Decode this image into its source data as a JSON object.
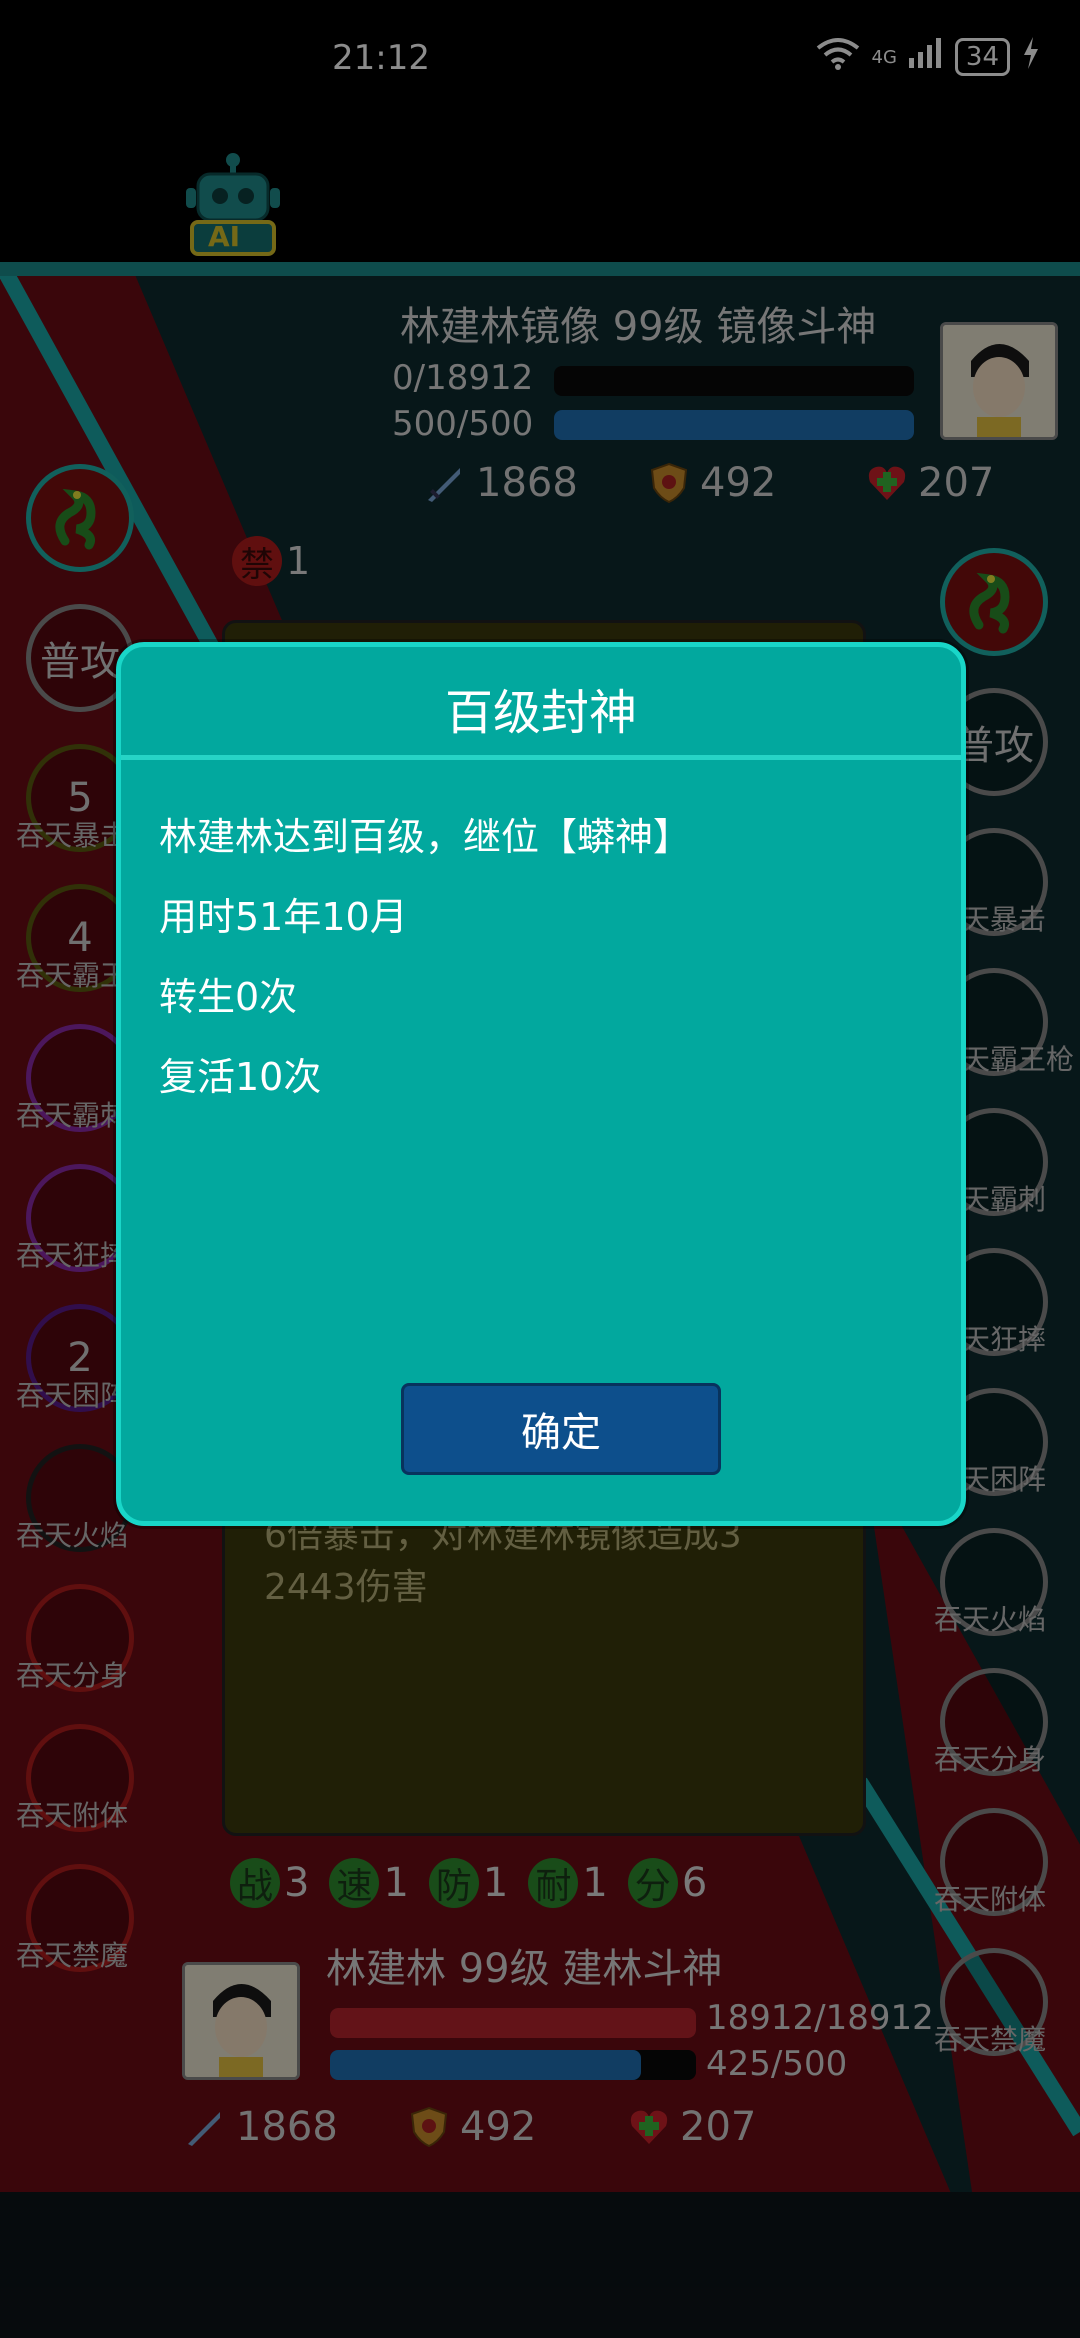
{
  "status_bar": {
    "time": "21:12",
    "network": "4G",
    "battery": "34"
  },
  "ai_button": {
    "label": "AI",
    "icon": "robot-icon"
  },
  "enemy": {
    "title": "林建林镜像 99级 镜像斗神",
    "hp_text": "0/18912",
    "mp_text": "500/500",
    "hp": 0,
    "hp_max": 18912,
    "mp": 500,
    "mp_max": 500,
    "attack": "1868",
    "defense": "492",
    "heal": "207",
    "ban_count": "1",
    "ban_label": "禁"
  },
  "left_skills": [
    {
      "text": "",
      "label": ""
    },
    {
      "text": "普攻",
      "label": ""
    },
    {
      "text": "5",
      "label": "吞天暴击"
    },
    {
      "text": "4",
      "label": "吞天霸王枪"
    },
    {
      "text": "",
      "label": "吞天霸刺"
    },
    {
      "text": "",
      "label": "吞天狂摔"
    },
    {
      "text": "2",
      "label": "吞天困阵"
    },
    {
      "text": "",
      "label": "吞天火焰"
    },
    {
      "text": "",
      "label": "吞天分身"
    },
    {
      "text": "",
      "label": "吞天附体"
    },
    {
      "text": "",
      "label": "吞天禁魔"
    }
  ],
  "right_skills": [
    {
      "text": "",
      "label": ""
    },
    {
      "text": "普攻",
      "label": ""
    },
    {
      "text": "",
      "label": "吞天暴击"
    },
    {
      "text": "",
      "label": "吞天霸王枪"
    },
    {
      "text": "",
      "label": "吞天霸刺"
    },
    {
      "text": "",
      "label": "吞天狂摔"
    },
    {
      "text": "",
      "label": "吞天困阵"
    },
    {
      "text": "",
      "label": "吞天火焰"
    },
    {
      "text": "",
      "label": "吞天分身"
    },
    {
      "text": "",
      "label": "吞天附体"
    },
    {
      "text": "",
      "label": "吞天禁魔"
    }
  ],
  "battle_log": {
    "line1": "6倍暴击，对林建林镜像造成3",
    "line2": "2443伤害"
  },
  "player_tags": [
    {
      "char": "战",
      "value": "3"
    },
    {
      "char": "速",
      "value": "1"
    },
    {
      "char": "防",
      "value": "1"
    },
    {
      "char": "耐",
      "value": "1"
    },
    {
      "char": "分",
      "value": "6"
    }
  ],
  "player": {
    "title": "林建林 99级 建林斗神",
    "hp_text": "18912/18912",
    "mp_text": "425/500",
    "hp": 18912,
    "hp_max": 18912,
    "mp": 425,
    "mp_max": 500,
    "attack": "1868",
    "defense": "492",
    "heal": "207"
  },
  "dialog": {
    "title": "百级封神",
    "line1": "林建林达到百级，继位【蟒神】",
    "line2": "用时51年10月",
    "line3": "转生0次",
    "line4": "复活10次",
    "confirm": "确定"
  },
  "colors": {
    "dialog_bg": "#02a89e",
    "dialog_border": "#19d6c8",
    "button": "#0d4f8c"
  }
}
